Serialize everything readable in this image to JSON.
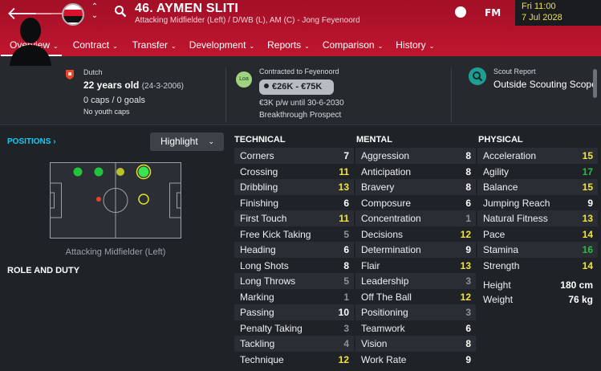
{
  "header": {
    "player_title": "46. AYMEN SLITI",
    "player_subtitle": "Attacking Midfielder (Left) / D/WB (L), AM (C) - Jong Feyenoord",
    "fm_logo": "FM",
    "date_line1": "Fri 11:00",
    "date_line2": "7 Jul 2028",
    "back_glyph": "🡐",
    "forward_glyph": "🡒",
    "up_glyph": "⌃",
    "down_glyph": "⌄",
    "club_colors": [
      "#d9112b",
      "#ffffff",
      "#111111"
    ]
  },
  "tabs": [
    {
      "label": "Overview"
    },
    {
      "label": "Contract"
    },
    {
      "label": "Transfer"
    },
    {
      "label": "Development"
    },
    {
      "label": "Reports"
    },
    {
      "label": "Comparison"
    },
    {
      "label": "History"
    }
  ],
  "tab_chevron": "⌄",
  "info": {
    "nationality": "Dutch",
    "age_label": "22 years old",
    "dob": "(24-3-2006)",
    "caps": "0 caps / 0 goals",
    "youth_caps": "No youth caps"
  },
  "contract": {
    "label": "Contracted to Feyenoord",
    "loan_badge": "Loa",
    "wage_range": "€26K - €75K",
    "wage_detail": "€3K p/w until 30-6-2030",
    "status": "Breakthrough Prospect"
  },
  "scout": {
    "label": "Scout Report",
    "value": "Outside Scouting Scope"
  },
  "positions": {
    "title": "POSITIONS",
    "title_chevron": "›",
    "highlight_label": "Highlight",
    "highlight_chevron": "⌄",
    "caption": "Attacking Midfielder (Left)"
  },
  "role": {
    "title": "ROLE AND DUTY"
  },
  "colors": {
    "header_red": "#b7112b",
    "accent_cyan": "#19c9f0",
    "high_green": "#21c23b",
    "good_yellow": "#f3e42e"
  },
  "technical": {
    "title": "TECHNICAL",
    "attrs": [
      {
        "name": "Corners",
        "value": "7",
        "tier": "v-wht"
      },
      {
        "name": "Crossing",
        "value": "11",
        "tier": "v-yel"
      },
      {
        "name": "Dribbling",
        "value": "13",
        "tier": "v-yel"
      },
      {
        "name": "Finishing",
        "value": "6",
        "tier": "v-wht"
      },
      {
        "name": "First Touch",
        "value": "11",
        "tier": "v-yel"
      },
      {
        "name": "Free Kick Taking",
        "value": "5",
        "tier": "v-gry"
      },
      {
        "name": "Heading",
        "value": "6",
        "tier": "v-wht"
      },
      {
        "name": "Long Shots",
        "value": "8",
        "tier": "v-wht"
      },
      {
        "name": "Long Throws",
        "value": "5",
        "tier": "v-gry"
      },
      {
        "name": "Marking",
        "value": "1",
        "tier": "v-gry"
      },
      {
        "name": "Passing",
        "value": "10",
        "tier": "v-wht"
      },
      {
        "name": "Penalty Taking",
        "value": "3",
        "tier": "v-gry"
      },
      {
        "name": "Tackling",
        "value": "4",
        "tier": "v-gry"
      },
      {
        "name": "Technique",
        "value": "12",
        "tier": "v-yel"
      }
    ]
  },
  "mental": {
    "title": "MENTAL",
    "attrs": [
      {
        "name": "Aggression",
        "value": "8",
        "tier": "v-wht"
      },
      {
        "name": "Anticipation",
        "value": "8",
        "tier": "v-wht"
      },
      {
        "name": "Bravery",
        "value": "8",
        "tier": "v-wht"
      },
      {
        "name": "Composure",
        "value": "6",
        "tier": "v-wht"
      },
      {
        "name": "Concentration",
        "value": "1",
        "tier": "v-gry"
      },
      {
        "name": "Decisions",
        "value": "12",
        "tier": "v-yel"
      },
      {
        "name": "Determination",
        "value": "9",
        "tier": "v-wht"
      },
      {
        "name": "Flair",
        "value": "13",
        "tier": "v-yel"
      },
      {
        "name": "Leadership",
        "value": "3",
        "tier": "v-gry"
      },
      {
        "name": "Off The Ball",
        "value": "12",
        "tier": "v-yel"
      },
      {
        "name": "Positioning",
        "value": "3",
        "tier": "v-gry"
      },
      {
        "name": "Teamwork",
        "value": "6",
        "tier": "v-wht"
      },
      {
        "name": "Vision",
        "value": "8",
        "tier": "v-wht"
      },
      {
        "name": "Work Rate",
        "value": "9",
        "tier": "v-wht"
      }
    ]
  },
  "physical": {
    "title": "PHYSICAL",
    "attrs": [
      {
        "name": "Acceleration",
        "value": "15",
        "tier": "v-yel"
      },
      {
        "name": "Agility",
        "value": "17",
        "tier": "v-hi"
      },
      {
        "name": "Balance",
        "value": "15",
        "tier": "v-yel"
      },
      {
        "name": "Jumping Reach",
        "value": "9",
        "tier": "v-wht"
      },
      {
        "name": "Natural Fitness",
        "value": "13",
        "tier": "v-yel"
      },
      {
        "name": "Pace",
        "value": "14",
        "tier": "v-yel"
      },
      {
        "name": "Stamina",
        "value": "16",
        "tier": "v-hi"
      },
      {
        "name": "Strength",
        "value": "14",
        "tier": "v-yel"
      }
    ],
    "height_label": "Height",
    "height_value": "180 cm",
    "weight_label": "Weight",
    "weight_value": "76 kg"
  }
}
